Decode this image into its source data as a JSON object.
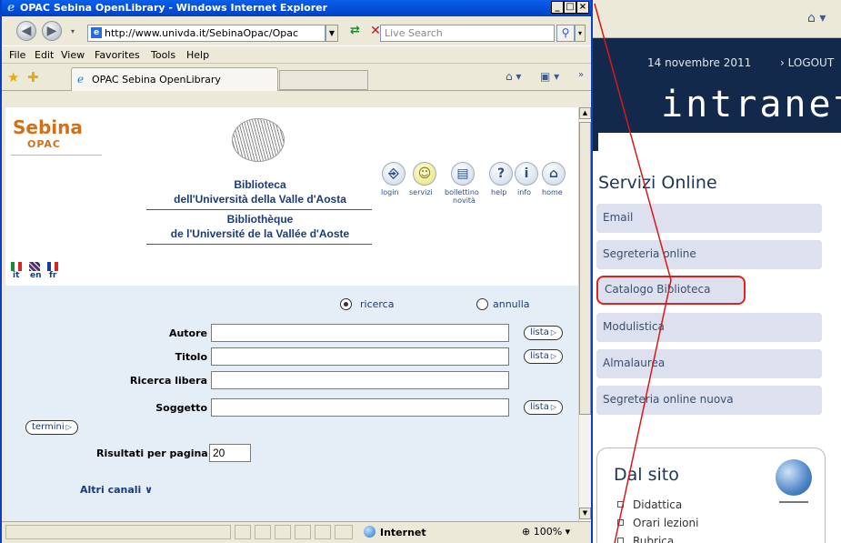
{
  "browser": {
    "title": "OPAC Sebina OpenLibrary - Windows Internet Explorer",
    "url": "http://www.univda.it/SebinaOpac/Opac",
    "search_placeholder": "Live Search",
    "menu": [
      "File",
      "Edit",
      "View",
      "Favorites",
      "Tools",
      "Help"
    ],
    "tab_title": "OPAC Sebina OpenLibrary",
    "status_zone": "Internet",
    "zoom": "100%"
  },
  "opac": {
    "logo_line1": "Sebina",
    "logo_line2": "OPAC",
    "library_it_1": "Biblioteca",
    "library_it_2": "dell'Università della Valle d'Aosta",
    "library_fr_1": "Bibliothèque",
    "library_fr_2": "de l'Université de la Vallée d'Aoste",
    "nav_icons": [
      {
        "label": "login",
        "glyph": "⎆"
      },
      {
        "label": "servizi",
        "glyph": "☺"
      },
      {
        "label": "bollettino",
        "label2": "novità",
        "glyph": "▤"
      },
      {
        "label": "help",
        "glyph": "?"
      },
      {
        "label": "info",
        "glyph": "i"
      },
      {
        "label": "home",
        "glyph": "⌂"
      }
    ],
    "languages": [
      "it",
      "en",
      "fr"
    ],
    "radio_search": "ricerca",
    "radio_cancel": "annulla",
    "fields": {
      "author": "Autore",
      "title": "Titolo",
      "free": "Ricerca libera",
      "subject": "Soggetto"
    },
    "list_button": "lista",
    "terms_button": "termini",
    "results_label": "Risultati per pagina",
    "results_value": "20",
    "other_channels": "Altri canali"
  },
  "intranet": {
    "date": "14 novembre 2011",
    "logout": "› LOGOUT",
    "brand": "intranet",
    "services_title": "Servizi Online",
    "services": [
      "Email",
      "Segreteria online",
      "Catalogo Biblioteca",
      "Modulistica",
      "Almalaurea",
      "Segreteria online nuova"
    ],
    "site_title": "Dal sito",
    "site_links": [
      "Didattica",
      "Orari lezioni",
      "Rubrica"
    ]
  },
  "colors": {
    "ie_title": "#0a5fe8",
    "intranet_banner": "#13294b",
    "highlight": "#dd2222",
    "sebina_orange": "#d0701c"
  }
}
